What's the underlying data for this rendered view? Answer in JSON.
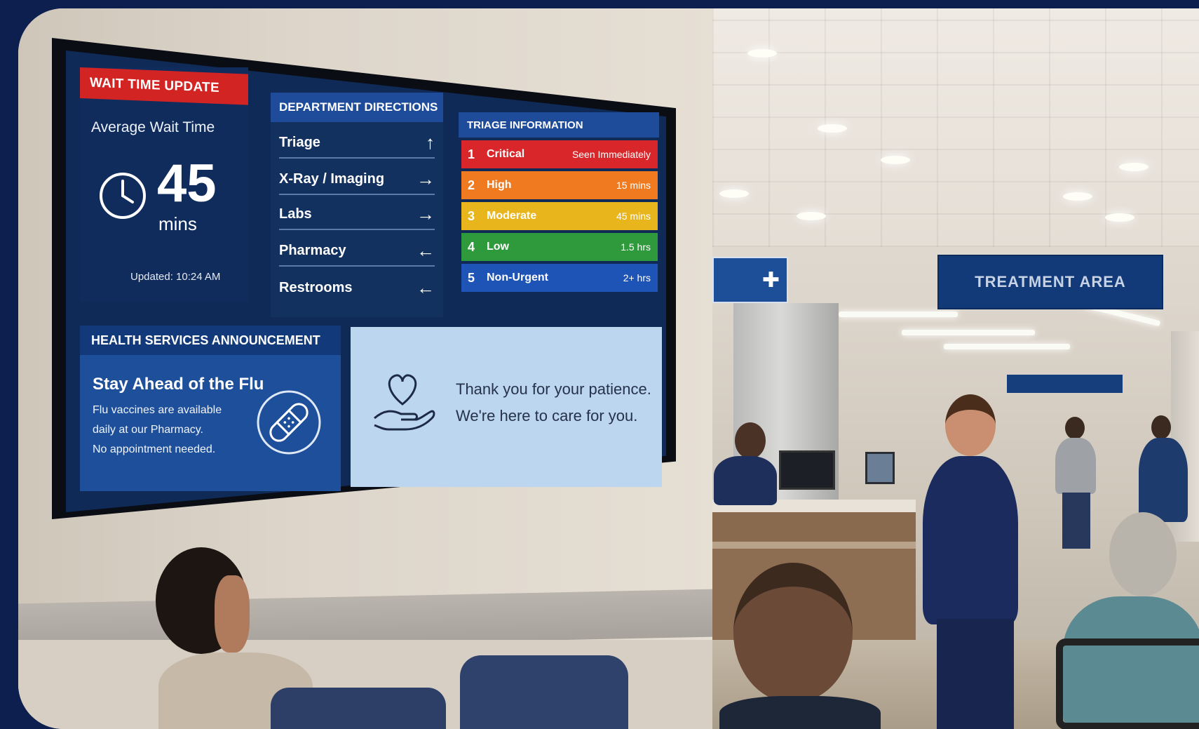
{
  "wait_panel": {
    "header": "WAIT TIME UPDATE",
    "label": "Average Wait Time",
    "value": "45",
    "unit": "mins",
    "updated": "Updated: 10:24 AM",
    "header_color": "#d32424"
  },
  "department_directions": {
    "header": "DEPARTMENT DIRECTIONS",
    "rows": [
      {
        "label": "Triage",
        "arrow": "↑"
      },
      {
        "label": "X-Ray / Imaging",
        "arrow": "→"
      },
      {
        "label": "Labs",
        "arrow": "→"
      },
      {
        "label": "Pharmacy",
        "arrow": "←"
      },
      {
        "label": "Restrooms",
        "arrow": "←"
      }
    ]
  },
  "triage": {
    "header": "TRIAGE INFORMATION",
    "rows": [
      {
        "num": "1",
        "level": "Critical",
        "time": "Seen Immediately",
        "color": "#d9262a"
      },
      {
        "num": "2",
        "level": "High",
        "time": "15 mins",
        "color": "#ef7a1f"
      },
      {
        "num": "3",
        "level": "Moderate",
        "time": "45 mins",
        "color": "#e8b61c"
      },
      {
        "num": "4",
        "level": "Low",
        "time": "1.5 hrs",
        "color": "#2f9a3c"
      },
      {
        "num": "5",
        "level": "Non-Urgent",
        "time": "2+ hrs",
        "color": "#1e54b6"
      }
    ]
  },
  "announcement": {
    "header": "HEALTH SERVICES ANNOUNCEMENT",
    "title": "Stay Ahead of the Flu",
    "lines": [
      "Flu vaccines are available",
      "daily at our Pharmacy.",
      "No appointment needed."
    ],
    "icon": "bandage-icon"
  },
  "thanks": {
    "line1": "Thank you for your patience.",
    "line2": "We're here to care for you.",
    "icon": "heart-hand-icon"
  },
  "scene": {
    "treatment_sign": "TREATMENT AREA"
  }
}
